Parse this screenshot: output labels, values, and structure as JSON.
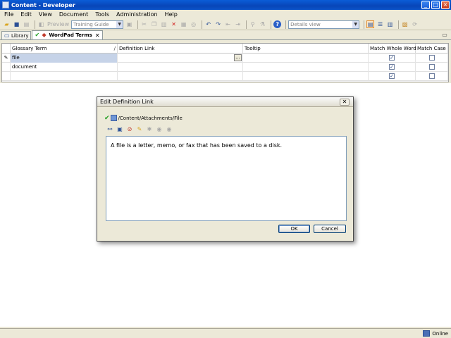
{
  "window": {
    "title": "Content - Developer"
  },
  "menu": {
    "items": [
      "File",
      "Edit",
      "View",
      "Document",
      "Tools",
      "Administration",
      "Help"
    ]
  },
  "toolbar": {
    "preview_label": "Preview",
    "guide_select": "Training Guide",
    "view_select": "Details view"
  },
  "tabs": [
    {
      "label": "Library",
      "active": false
    },
    {
      "label": "WordPad Terms",
      "active": true
    }
  ],
  "grid": {
    "columns": [
      "Glossary Term",
      "Definition Link",
      "Tooltip",
      "Match Whole Word",
      "Match Case"
    ],
    "sort_indicator": "/",
    "rows": [
      {
        "term": "file",
        "link": "",
        "tooltip": "",
        "whole_word": true,
        "match_case": false,
        "editing": true
      },
      {
        "term": "document",
        "link": "",
        "tooltip": "",
        "whole_word": true,
        "match_case": false,
        "editing": false
      },
      {
        "term": "",
        "link": "",
        "tooltip": "",
        "whole_word": true,
        "match_case": false,
        "editing": false
      }
    ],
    "ellipsis": "...",
    "edit_indicator": "✎"
  },
  "dialog": {
    "title": "Edit Definition Link",
    "path": "/Content/Attachments/File",
    "text": "A file is a letter, memo, or fax that has been saved to a disk.",
    "ok_label": "OK",
    "cancel_label": "Cancel"
  },
  "status": {
    "online_label": "Online"
  }
}
